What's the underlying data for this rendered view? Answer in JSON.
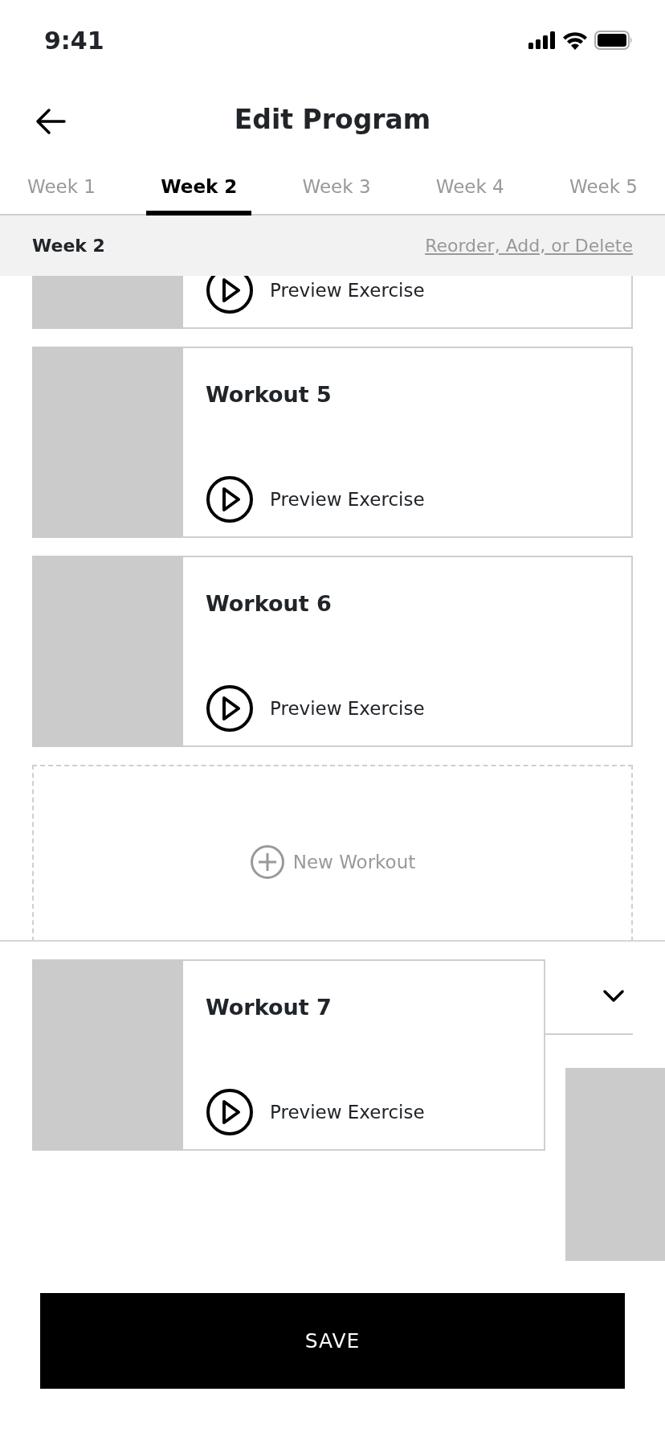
{
  "status_bar": {
    "time": "9:41"
  },
  "header": {
    "title": "Edit Program"
  },
  "tabs": [
    {
      "label": "Week 1",
      "selected": false
    },
    {
      "label": "Week 2",
      "selected": true
    },
    {
      "label": "Week 3",
      "selected": false
    },
    {
      "label": "Week 4",
      "selected": false
    },
    {
      "label": "Week 5",
      "selected": false
    }
  ],
  "section": {
    "title": "Week 2",
    "action": "Reorder, Add, or Delete"
  },
  "workouts": [
    {
      "preview": "Preview Exercise"
    },
    {
      "title": "Workout 5",
      "preview": "Preview Exercise"
    },
    {
      "title": "Workout 6",
      "preview": "Preview Exercise"
    }
  ],
  "new_workout": {
    "label": "New Workout"
  },
  "dragged_workout": {
    "title": "Workout 7",
    "preview": "Preview Exercise"
  },
  "save_button": {
    "label": "SAVE"
  }
}
